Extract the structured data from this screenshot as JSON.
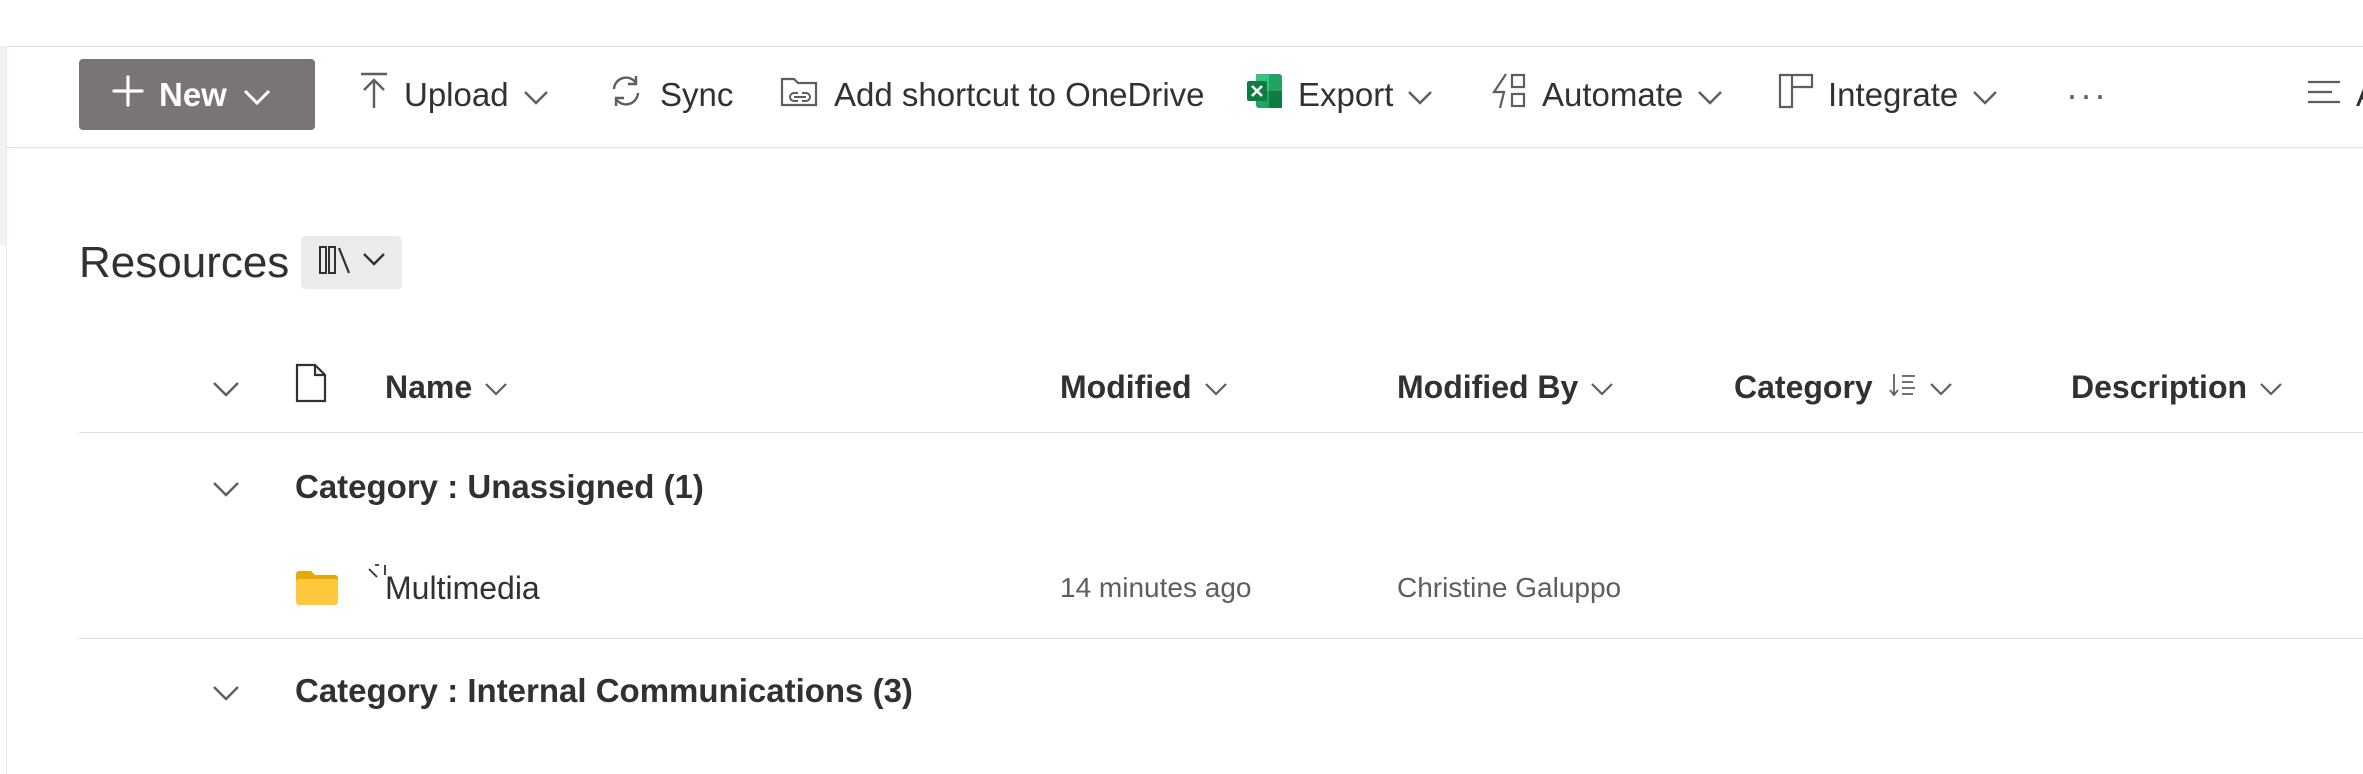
{
  "commandbar": {
    "new_label": "New",
    "upload_label": "Upload",
    "sync_label": "Sync",
    "shortcut_label": "Add shortcut to OneDrive",
    "export_label": "Export",
    "automate_label": "Automate",
    "integrate_label": "Integrate",
    "more_label": "···",
    "right_partial_label": "A"
  },
  "library": {
    "title": "Resources"
  },
  "columns": {
    "name": "Name",
    "modified": "Modified",
    "modified_by": "Modified By",
    "category": "Category",
    "description": "Description"
  },
  "groups": [
    {
      "title": "Category : Unassigned (1)",
      "items": [
        {
          "name": "Multimedia",
          "modified": "14 minutes ago",
          "modified_by": "Christine Galuppo",
          "type": "folder"
        }
      ]
    },
    {
      "title": "Category : Internal Communications (3)"
    }
  ],
  "colors": {
    "new_button": "#7a7574",
    "folder": "#ffc83d",
    "excel": "#107c41"
  }
}
